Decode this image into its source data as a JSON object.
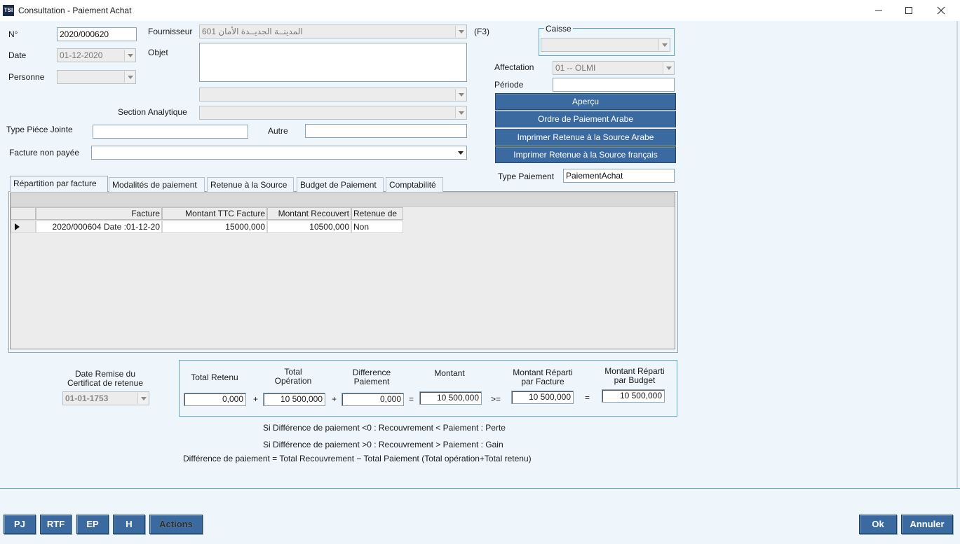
{
  "window": {
    "app_icon": "TSI",
    "title": "Consultation - Paiement Achat",
    "minimize_icon": "minimize-icon",
    "maximize_icon": "maximize-icon",
    "close_icon": "close-icon"
  },
  "form": {
    "numero_label": "N°",
    "numero_value": "2020/000620",
    "date_label": "Date",
    "date_value": "01-12-2020",
    "personne_label": "Personne",
    "personne_value": "",
    "fournisseur_label": "Fournisseur",
    "fournisseur_value": "601 المدينــة الجديــدة الأمان",
    "fournisseur_shortcut": "(F3)",
    "objet_label": "Objet",
    "objet_value": "",
    "extra_dropdown_value": "",
    "section_label": "Section Analytique",
    "section_value": "",
    "type_piece_label": "Type Piéce Jointe",
    "type_piece_value": "",
    "autre_label": "Autre",
    "autre_value": "",
    "facture_np_label": "Facture non payée",
    "facture_np_value": ""
  },
  "right_panel": {
    "caisse_label": "Caisse",
    "caisse_value": "",
    "affectation_label": "Affectation",
    "affectation_value": "01 -- OLMI",
    "periode_label": "Période",
    "periode_value": "",
    "buttons": {
      "apercu": "Aperçu",
      "ordre_arabe": "Ordre de Paiement Arabe",
      "retenue_arabe": "Imprimer Retenue à la Source Arabe",
      "retenue_fr": "Imprimer Retenue à la Source français"
    },
    "type_paiement_label": "Type Paiement",
    "type_paiement_value": "PaiementAchat"
  },
  "tabs": [
    {
      "label": "Répartition par facture",
      "active": true
    },
    {
      "label": "Modalités de paiement"
    },
    {
      "label": "Retenue à la Source"
    },
    {
      "label": "Budget de Paiement"
    },
    {
      "label": "Comptabilité"
    }
  ],
  "grid": {
    "columns": [
      "Facture",
      "Montant TTC Facture",
      "Montant Recouvert",
      "Retenue de"
    ],
    "rows": [
      {
        "facture": "2020/000604 Date :01-12-20",
        "montant_ttc": "15000,000",
        "montant_recouvert": "10500,000",
        "retenue": "Non"
      }
    ]
  },
  "certificat": {
    "label_line1": "Date Remise du",
    "label_line2": "Certificat de retenue",
    "value": "01-01-1753"
  },
  "totals": {
    "total_retenu_label": "Total Retenu",
    "total_retenu": "0,000",
    "total_operation_label_1": "Total",
    "total_operation_label_2": "Opération",
    "total_operation": "10 500,000",
    "difference_label_1": "Difference",
    "difference_label_2": "Paiement",
    "difference": "0,000",
    "montant_label": "Montant",
    "montant": "10 500,000",
    "reparti_facture_label_1": "Montant Réparti",
    "reparti_facture_label_2": "par Facture",
    "reparti_facture": "10 500,000",
    "reparti_budget_label_1": "Montant Réparti",
    "reparti_budget_label_2": "par Budget",
    "reparti_budget": "10 500,000",
    "op_plus": "+",
    "op_eq": "=",
    "op_ge": ">=",
    "op_eq2": "="
  },
  "notes": {
    "line1": "Si Différence de paiement <0 : Recouvrement < Paiement : Perte",
    "line2": "Si Différence de paiement >0 : Recouvrement > Paiement : Gain",
    "line3": "Différence de paiement = Total Recouvrement − Total Paiement (Total opération+Total retenu)"
  },
  "bottom_buttons": {
    "pj": "PJ",
    "rtf": "RTF",
    "ep": "EP",
    "h": "H",
    "actions": "Actions",
    "ok": "Ok",
    "annuler": "Annuler"
  }
}
